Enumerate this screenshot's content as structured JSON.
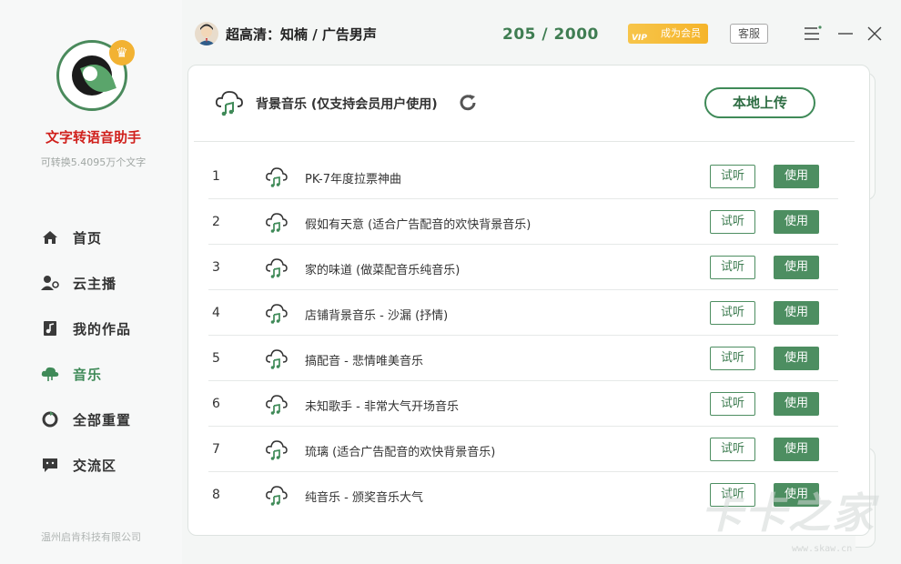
{
  "app": {
    "name": "文字转语音助手",
    "subtitle": "可转换5.4095万个文字",
    "company": "温州启肯科技有限公司"
  },
  "nav": {
    "items": [
      {
        "label": "首页",
        "icon": "home-icon"
      },
      {
        "label": "云主播",
        "icon": "anchor-icon"
      },
      {
        "label": "我的作品",
        "icon": "works-icon"
      },
      {
        "label": "音乐",
        "icon": "music-cloud-icon",
        "active": true
      },
      {
        "label": "全部重置",
        "icon": "reset-icon"
      },
      {
        "label": "交流区",
        "icon": "chat-icon"
      }
    ]
  },
  "header": {
    "voice": "超高清：知楠 / 广告男声",
    "counter": "205 / 2000",
    "vip_tag": "VIP",
    "vip_label": "成为会员",
    "service_label": "客服"
  },
  "panel": {
    "title": "背景音乐 (仅支持会员用户使用)",
    "upload_label": "本地上传",
    "listen_label": "试听",
    "use_label": "使用",
    "tracks": [
      {
        "num": "1",
        "name": "PK-7年度拉票神曲"
      },
      {
        "num": "2",
        "name": "假如有天意 (适合广告配音的欢快背景音乐)"
      },
      {
        "num": "3",
        "name": "家的味道 (做菜配音乐纯音乐)"
      },
      {
        "num": "4",
        "name": "店铺背景音乐 - 沙漏 (抒情)"
      },
      {
        "num": "5",
        "name": "搞配音 - 悲情唯美音乐"
      },
      {
        "num": "6",
        "name": "未知歌手 - 非常大气开场音乐"
      },
      {
        "num": "7",
        "name": "琉璃 (适合广告配音的欢快背景音乐)"
      },
      {
        "num": "8",
        "name": "纯音乐 - 颁奖音乐大气"
      }
    ]
  },
  "watermark": {
    "text": "卡卡之家",
    "url": "www.skaw.cn"
  },
  "colors": {
    "accent": "#4d8e61",
    "brand_red": "#d0201c",
    "vip_gold": "#f5b42a"
  }
}
